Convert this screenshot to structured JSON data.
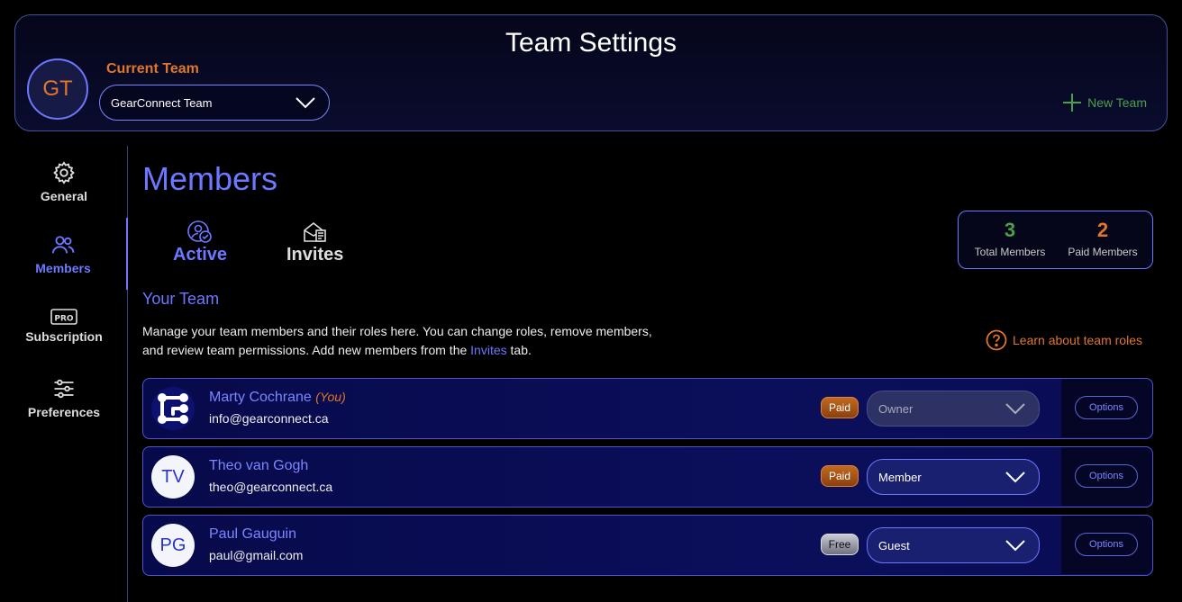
{
  "header": {
    "title": "Team Settings",
    "team_initials": "GT",
    "current_team_label": "Current Team",
    "selected_team": "GearConnect Team",
    "new_team_label": "New Team"
  },
  "sidebar": {
    "items": [
      {
        "label": "General",
        "icon": "gear-icon"
      },
      {
        "label": "Members",
        "icon": "users-icon"
      },
      {
        "label": "Subscription",
        "icon": "pro-icon"
      },
      {
        "label": "Preferences",
        "icon": "sliders-icon"
      }
    ]
  },
  "main": {
    "title": "Members",
    "tabs": [
      {
        "label": "Active",
        "icon": "user-check-icon"
      },
      {
        "label": "Invites",
        "icon": "envelope-icon"
      }
    ],
    "stats": {
      "total": "3",
      "total_label": "Total Members",
      "paid": "2",
      "paid_label": "Paid Members"
    },
    "section_title": "Your Team",
    "description_line1": "Manage your team members and their roles here. You can change roles, remove members,",
    "description_line2_pre": "and review team permissions. Add new members from the ",
    "description_link": "Invites",
    "description_line2_post": " tab.",
    "learn_label": "Learn about team roles",
    "members": [
      {
        "initials": "",
        "name": "Marty Cochrane",
        "you_label": "(You)",
        "email": "info@gearconnect.ca",
        "badge": "Paid",
        "role": "Owner",
        "options": "Options"
      },
      {
        "initials": "TV",
        "name": "Theo van Gogh",
        "email": "theo@gearconnect.ca",
        "badge": "Paid",
        "role": "Member",
        "options": "Options"
      },
      {
        "initials": "PG",
        "name": "Paul Gauguin",
        "email": "paul@gmail.com",
        "badge": "Free",
        "role": "Guest",
        "options": "Options"
      }
    ]
  },
  "colors": {
    "accent": "#6c78ff",
    "orange": "#e0762b",
    "green": "#4aa04a"
  }
}
